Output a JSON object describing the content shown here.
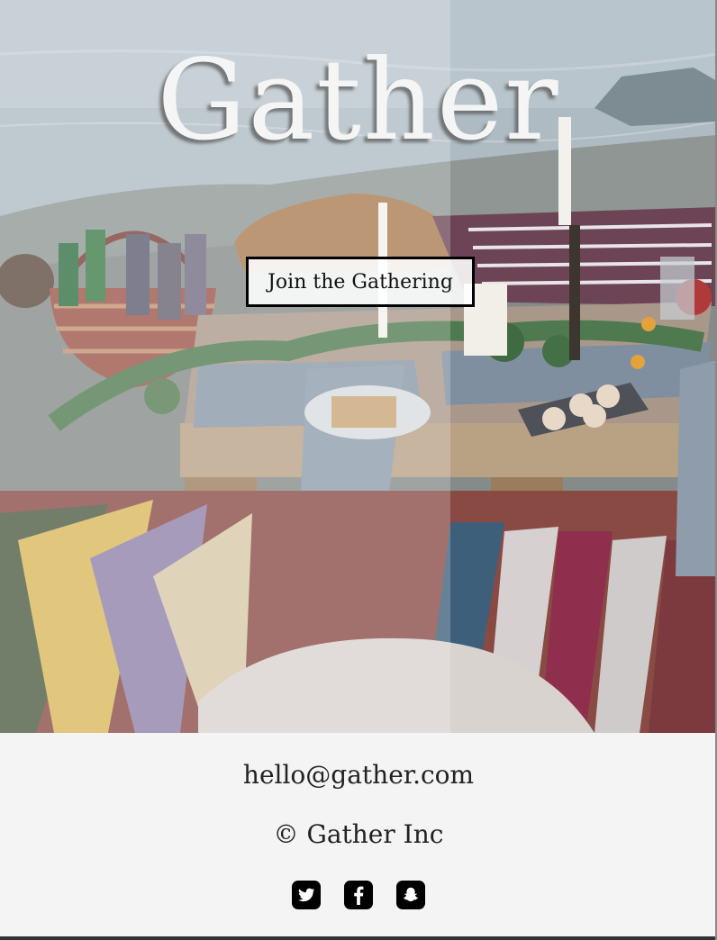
{
  "hero": {
    "title": "Gather",
    "cta_label": "Join the Gathering"
  },
  "footer": {
    "email": "hello@gather.com",
    "copyright": "© Gather Inc",
    "social": [
      {
        "icon": "twitter-icon"
      },
      {
        "icon": "facebook-icon"
      },
      {
        "icon": "snapchat-icon"
      }
    ]
  },
  "colors": {
    "footer_background": "#f4f4f4",
    "button_border": "#000000",
    "icon_color": "#000000"
  }
}
